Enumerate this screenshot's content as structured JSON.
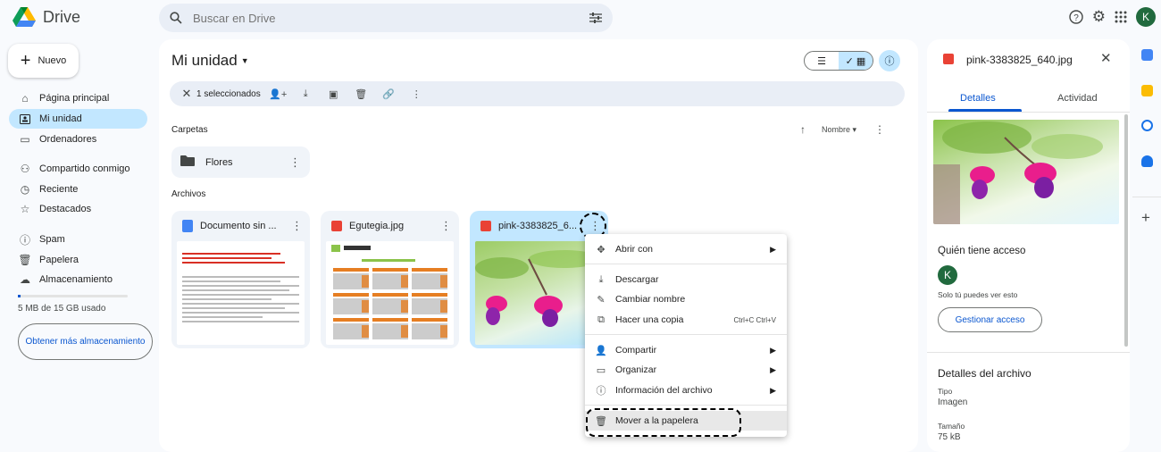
{
  "app": {
    "name": "Drive"
  },
  "search": {
    "placeholder": "Buscar en Drive"
  },
  "user": {
    "initial": "K"
  },
  "sidebar": {
    "new_label": "Nuevo",
    "items": [
      {
        "label": "Página principal"
      },
      {
        "label": "Mi unidad"
      },
      {
        "label": "Ordenadores"
      },
      {
        "label": "Compartido conmigo"
      },
      {
        "label": "Reciente"
      },
      {
        "label": "Destacados"
      },
      {
        "label": "Spam"
      },
      {
        "label": "Papelera"
      },
      {
        "label": "Almacenamiento"
      }
    ],
    "storage_text": "5 MB de 15 GB usado",
    "get_storage": "Obtener más almacenamiento"
  },
  "main": {
    "title": "Mi unidad",
    "selection": "1 seleccionados",
    "folders_label": "Carpetas",
    "files_label": "Archivos",
    "sort_label": "Nombre",
    "folders": [
      {
        "name": "Flores"
      }
    ],
    "files": [
      {
        "name": "Documento sin ..."
      },
      {
        "name": "Egutegia.jpg"
      },
      {
        "name": "pink-3383825_6..."
      }
    ]
  },
  "menu": {
    "open_with": "Abrir con",
    "download": "Descargar",
    "rename": "Cambiar nombre",
    "copy": "Hacer una copia",
    "copy_shortcut": "Ctrl+C Ctrl+V",
    "share": "Compartir",
    "organize": "Organizar",
    "file_info": "Información del archivo",
    "trash": "Mover a la papelera"
  },
  "details": {
    "title": "pink-3383825_640.jpg",
    "tab_details": "Detalles",
    "tab_activity": "Actividad",
    "access_heading": "Quién tiene acceso",
    "access_note": "Solo tú puedes ver esto",
    "manage_access": "Gestionar acceso",
    "file_details_heading": "Detalles del archivo",
    "type_label": "Tipo",
    "type_value": "Imagen",
    "size_label": "Tamaño",
    "size_value": "75 kB"
  },
  "colors": {
    "accent": "#0b57d0",
    "selected": "#c2e7ff",
    "avatar": "#216a3e"
  }
}
